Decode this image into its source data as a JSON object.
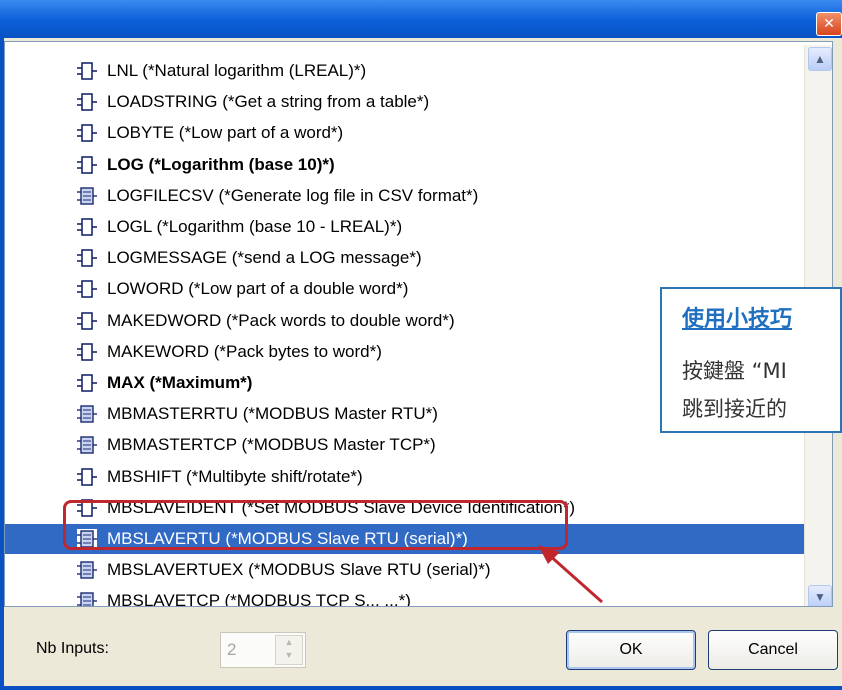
{
  "window": {
    "close_glyph": "✕"
  },
  "list": {
    "items": [
      {
        "label": "LNL (*Natural logarithm (LREAL)*)",
        "icon": "function-block-icon",
        "bold": false,
        "selected": false
      },
      {
        "label": "LOADSTRING (*Get a string from a table*)",
        "icon": "function-block-icon",
        "bold": false,
        "selected": false
      },
      {
        "label": "LOBYTE (*Low part of a word*)",
        "icon": "function-block-icon",
        "bold": false,
        "selected": false
      },
      {
        "label": "LOG (*Logarithm (base 10)*)",
        "icon": "function-block-icon",
        "bold": true,
        "selected": false
      },
      {
        "label": "LOGFILECSV (*Generate log file in CSV format*)",
        "icon": "module-block-icon",
        "bold": false,
        "selected": false
      },
      {
        "label": "LOGL (*Logarithm (base 10 - LREAL)*)",
        "icon": "function-block-icon",
        "bold": false,
        "selected": false
      },
      {
        "label": "LOGMESSAGE (*send a LOG message*)",
        "icon": "function-block-icon",
        "bold": false,
        "selected": false
      },
      {
        "label": "LOWORD (*Low part of a double word*)",
        "icon": "function-block-icon",
        "bold": false,
        "selected": false
      },
      {
        "label": "MAKEDWORD (*Pack words to double word*)",
        "icon": "function-block-icon",
        "bold": false,
        "selected": false
      },
      {
        "label": "MAKEWORD (*Pack bytes to word*)",
        "icon": "function-block-icon",
        "bold": false,
        "selected": false
      },
      {
        "label": "MAX (*Maximum*)",
        "icon": "function-block-icon",
        "bold": true,
        "selected": false
      },
      {
        "label": "MBMASTERRTU (*MODBUS Master RTU*)",
        "icon": "module-block-icon",
        "bold": false,
        "selected": false
      },
      {
        "label": "MBMASTERTCP (*MODBUS Master TCP*)",
        "icon": "module-block-icon",
        "bold": false,
        "selected": false
      },
      {
        "label": "MBSHIFT (*Multibyte shift/rotate*)",
        "icon": "function-block-icon",
        "bold": false,
        "selected": false
      },
      {
        "label": "MBSLAVEIDENT (*Set MODBUS Slave Device Identification*)",
        "icon": "function-block-icon",
        "bold": false,
        "selected": false
      },
      {
        "label": "MBSLAVERTU (*MODBUS Slave RTU (serial)*)",
        "icon": "module-block-icon",
        "bold": false,
        "selected": true
      },
      {
        "label": "MBSLAVERTUEX (*MODBUS Slave RTU (serial)*)",
        "icon": "module-block-icon",
        "bold": false,
        "selected": false
      },
      {
        "label": "MBSLAVETCP (*MODBUS TCP S... ...*)",
        "icon": "module-block-icon",
        "bold": false,
        "selected": false
      }
    ]
  },
  "callout": {
    "title": "使用小技巧",
    "line1": "按鍵盤 “MI",
    "line2": "跳到接近的"
  },
  "footer": {
    "nb_inputs_label": "Nb Inputs:",
    "nb_inputs_value": "2",
    "ok_label": "OK",
    "cancel_label": "Cancel"
  },
  "colors": {
    "selection": "#316ac5",
    "highlight_box": "#c0262d",
    "callout_accent": "#1f6fc0"
  }
}
